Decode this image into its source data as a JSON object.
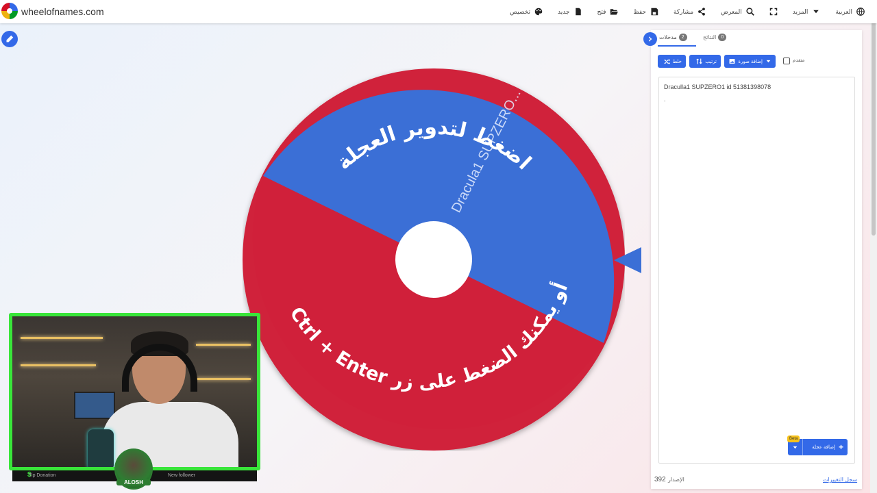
{
  "site": {
    "name": "wheelofnames.com"
  },
  "nav": [
    {
      "label": "العربية",
      "icon": "globe-icon"
    },
    {
      "label": "المزيد",
      "icon": "caret-down-icon"
    },
    {
      "label": "",
      "icon": "fullscreen-icon"
    },
    {
      "label": "المعرض",
      "icon": "search-icon"
    },
    {
      "label": "مشاركة",
      "icon": "share-icon"
    },
    {
      "label": "حفظ",
      "icon": "save-icon"
    },
    {
      "label": "فتح",
      "icon": "folder-open-icon"
    },
    {
      "label": "جديد",
      "icon": "new-file-icon"
    },
    {
      "label": "تخصيص",
      "icon": "palette-icon"
    }
  ],
  "wheel": {
    "slices": [
      {
        "label": "Dracula1 SUPZERO...",
        "color": "#3b6fd6"
      },
      {
        "label": "",
        "color": "#d0203a"
      }
    ],
    "hint_top": "اضغط لتدوير العجلة",
    "hint_bottom": "أو يمكنك الضغط على زر Ctrl + Enter",
    "pointer_color": "#3b6fd6"
  },
  "webcam": {
    "tip_label": "Tip Donation",
    "follower_label": "New follower",
    "badge_label": "ALOSH",
    "frame_color": "#39e53a"
  },
  "panel": {
    "tabs": [
      {
        "label": "مدخلات",
        "count": "2"
      },
      {
        "label": "النتائج",
        "count": "0"
      }
    ],
    "buttons": {
      "shuffle": "خلط",
      "sort": "ترتيب",
      "add_image": "إضافة صورة"
    },
    "advanced_label": "متقدم",
    "entries": [
      "Draculla1 SUPZERO1 id 51381398078",
      "."
    ],
    "add_wheel": "إضافة عجلة",
    "beta": "Beta",
    "version_label": "الإصدار",
    "version_number": "392",
    "changelog": "سجل التغييرات"
  },
  "colors": {
    "accent": "#3369e8"
  }
}
